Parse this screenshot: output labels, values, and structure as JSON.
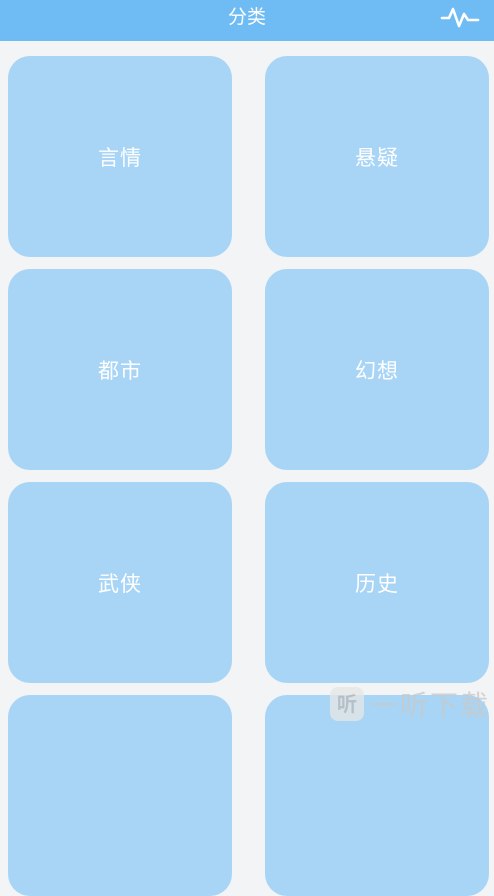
{
  "header": {
    "title": "分类",
    "action_icon": "pulse-icon"
  },
  "categories": [
    {
      "label": "言情"
    },
    {
      "label": "悬疑"
    },
    {
      "label": "都市"
    },
    {
      "label": "幻想"
    },
    {
      "label": "武侠"
    },
    {
      "label": "历史"
    },
    {
      "label": ""
    },
    {
      "label": ""
    }
  ],
  "watermark": {
    "logo": "听",
    "text": "一听下载"
  },
  "colors": {
    "header_bg": "#6fbcf5",
    "tile_bg": "#a8d5f6",
    "page_bg": "#f3f4f6",
    "text": "#ffffff"
  }
}
